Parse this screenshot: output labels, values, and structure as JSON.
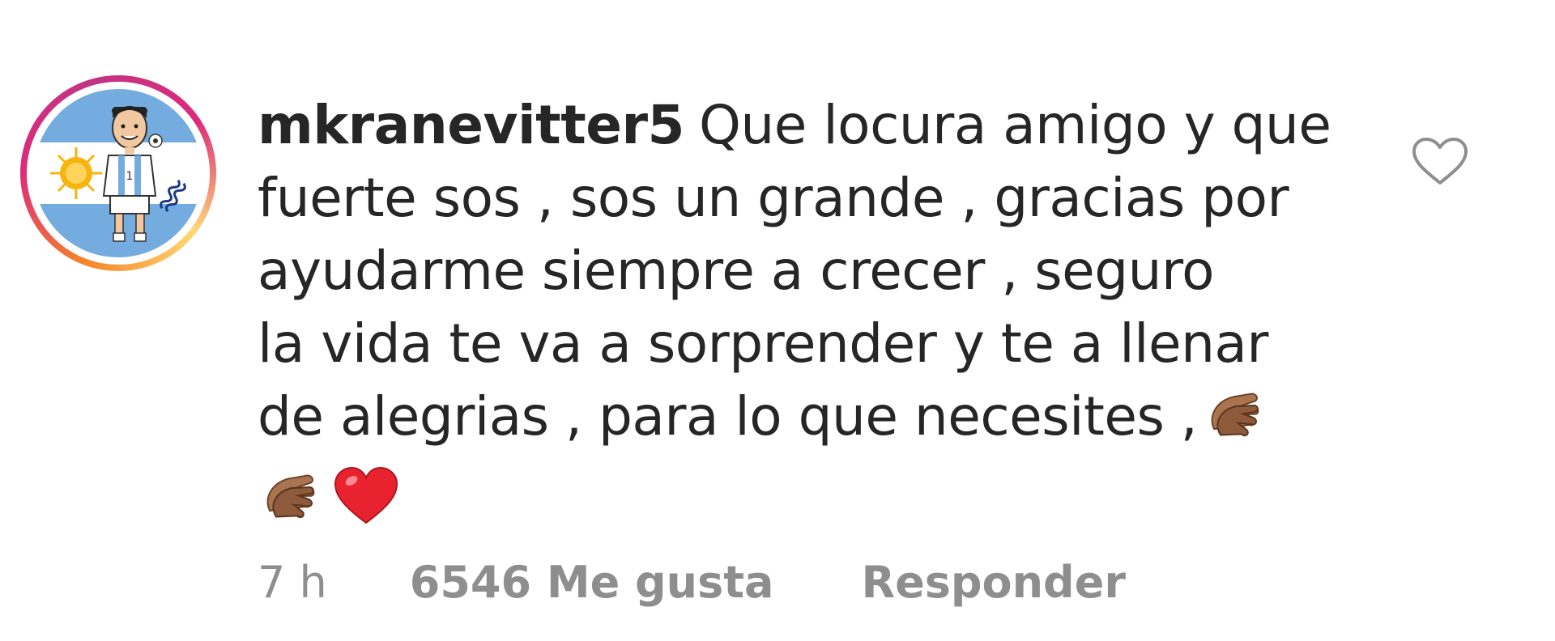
{
  "comment": {
    "username": "mkranevitter5",
    "text_lines": [
      "Que locura amigo y que",
      "fuerte sos , sos un grande , gracias por",
      "ayudarme siempre a crecer , seguro",
      "la vida te va a sorprender y te a llenar",
      "de alegrias , para lo que necesites ,"
    ],
    "emojis": [
      "clapping-hands",
      "clapping-hands",
      "red-heart"
    ],
    "time": "7 h",
    "likes": "6546 Me gusta",
    "reply_label": "Responder"
  },
  "colors": {
    "text": "#262626",
    "meta": "#8e8e8e",
    "heart_outline": "#8e8e8e",
    "heart_emoji": "#e8232f",
    "flag_blue": "#74acdf"
  },
  "icons": {
    "like": "heart-outline-icon"
  }
}
